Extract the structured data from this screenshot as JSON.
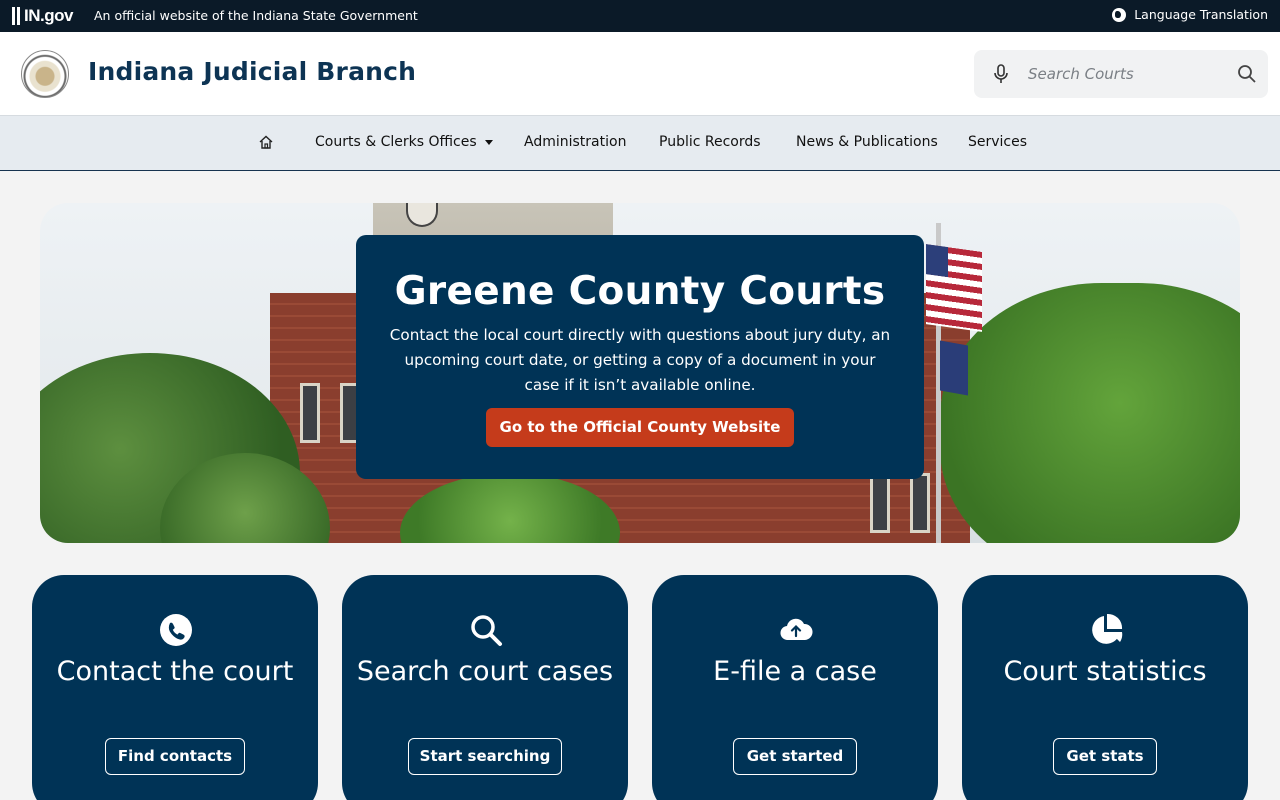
{
  "govbar": {
    "logo_text": "IN.gov",
    "official_text": "An official website of the Indiana State Government",
    "language_label": "Language Translation"
  },
  "header": {
    "site_title": "Indiana Judicial Branch",
    "search_placeholder": "Search Courts"
  },
  "nav": {
    "items": [
      {
        "label": "Courts & Clerks Offices"
      },
      {
        "label": "Administration"
      },
      {
        "label": "Public Records"
      },
      {
        "label": "News & Publications"
      },
      {
        "label": "Services"
      }
    ]
  },
  "hero": {
    "title": "Greene County Courts",
    "description": "Contact the local court directly with questions about jury duty, an upcoming court date, or getting a copy of a document in your case if it isn’t available online.",
    "cta_label": "Go to the Official County Website"
  },
  "tiles": [
    {
      "icon": "phone-icon",
      "title": "Contact the court",
      "button": "Find contacts"
    },
    {
      "icon": "search-icon",
      "title": "Search court cases",
      "button": "Start searching"
    },
    {
      "icon": "cloud-upload-icon",
      "title": "E-file a case",
      "button": "Get started"
    },
    {
      "icon": "pie-chart-icon",
      "title": "Court statistics",
      "button": "Get stats"
    }
  ],
  "colors": {
    "navy": "#003356",
    "govbar": "#0b1a28",
    "cta": "#c53b1b",
    "nav_bg": "#e6ebf0"
  }
}
